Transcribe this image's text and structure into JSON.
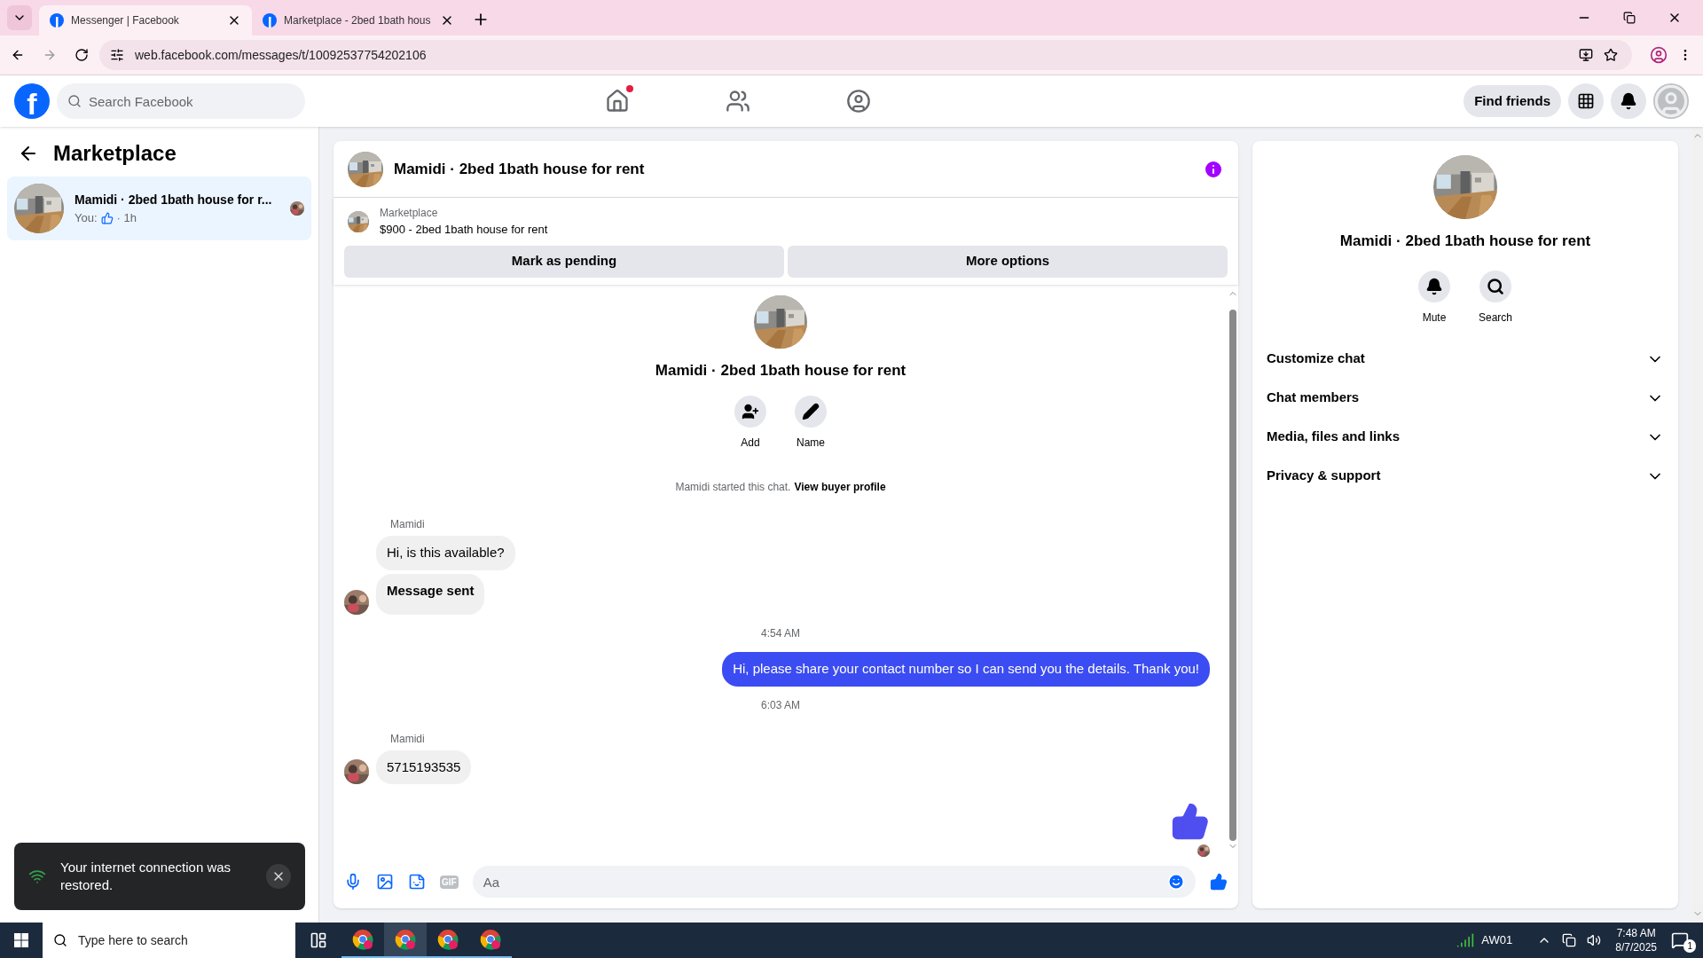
{
  "browser": {
    "tabs": [
      {
        "title": "Messenger | Facebook",
        "selected": true
      },
      {
        "title": "Marketplace - 2bed 1bath hous",
        "selected": false
      }
    ],
    "url": "web.facebook.com/messages/t/10092537754202106"
  },
  "header": {
    "logo": "f",
    "search_placeholder": "Search Facebook",
    "nav": [
      {
        "kind": "home",
        "notification": true
      },
      {
        "kind": "friends",
        "notification": false
      },
      {
        "kind": "groups",
        "notification": false
      }
    ],
    "find_friends": "Find friends"
  },
  "sidebar": {
    "title": "Marketplace",
    "chats": [
      {
        "name": "Mamidi · 2bed 1bath house for r...",
        "preview_prefix": "You:",
        "time": "· 1h",
        "selected": true
      }
    ]
  },
  "chat": {
    "title": "Mamidi · 2bed 1bath house for rent",
    "listing": {
      "source": "Marketplace",
      "summary": "$900 - 2bed 1bath house for rent"
    },
    "actions": [
      "Mark as pending",
      "More options"
    ],
    "intro": {
      "title": "Mamidi · 2bed 1bath house for rent",
      "buttons": [
        {
          "kind": "add",
          "label": "Add"
        },
        {
          "kind": "name",
          "label": "Name"
        }
      ],
      "notice": "Mamidi started this chat.",
      "notice_link": "View buyer profile"
    },
    "messages": [
      {
        "kind": "sender",
        "text": "Mamidi"
      },
      {
        "kind": "incoming",
        "text": "Hi, is this available?",
        "avatar": false,
        "bold": false
      },
      {
        "kind": "incoming",
        "text": "Message sent",
        "avatar": true,
        "bold": true
      },
      {
        "kind": "time",
        "text": "4:54 AM"
      },
      {
        "kind": "outgoing",
        "text": "Hi, please share your contact number so I can send you the details. Thank you!"
      },
      {
        "kind": "time",
        "text": "6:03 AM"
      },
      {
        "kind": "sender",
        "text": "Mamidi"
      },
      {
        "kind": "incoming",
        "text": "5715193535",
        "avatar": true,
        "bold": false
      },
      {
        "kind": "like"
      }
    ],
    "composer": {
      "placeholder": "Aa",
      "gif": "GIF"
    }
  },
  "details": {
    "title": "Mamidi · 2bed 1bath house for rent",
    "buttons": [
      {
        "kind": "mute",
        "label": "Mute"
      },
      {
        "kind": "search",
        "label": "Search"
      }
    ],
    "sections": [
      {
        "label": "Customize chat",
        "expanded": false
      },
      {
        "label": "Chat members",
        "expanded": false
      },
      {
        "label": "Media, files and links",
        "expanded": false
      },
      {
        "label": "Privacy & support",
        "expanded": false
      }
    ]
  },
  "toast": {
    "text": "Your internet connection was restored."
  },
  "taskbar": {
    "search_placeholder": "Type here to search",
    "network": "AW01",
    "time": "7:48 AM",
    "date": "8/7/2025",
    "notifications": "1"
  }
}
